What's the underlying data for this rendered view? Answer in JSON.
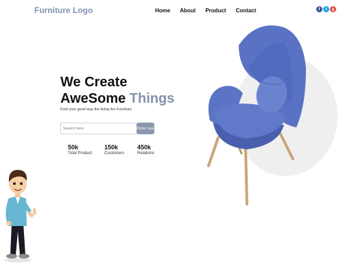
{
  "header": {
    "logo": "Furniture Logo",
    "nav": [
      "Home",
      "About",
      "Product",
      "Contact"
    ],
    "social_icons": [
      "facebook-icon",
      "twitter-icon",
      "google-plus-icon"
    ]
  },
  "hero": {
    "title_line1": "We Create",
    "title_line2_main": "AweSome",
    "title_line2_highlight": "Things",
    "tagline": "Find your good way the living the Furniture"
  },
  "search": {
    "placeholder": "Search here",
    "value": "",
    "button_label": "Order now"
  },
  "stats": [
    {
      "value": "50k",
      "label": "Total Product"
    },
    {
      "value": "150k",
      "label": "Customers"
    },
    {
      "value": "450k",
      "label": "Relations"
    }
  ],
  "colors": {
    "accent": "#8492a8",
    "logo": "#7f93b0",
    "chair_fabric": "#5a72c4",
    "button": "#8a97ad"
  }
}
